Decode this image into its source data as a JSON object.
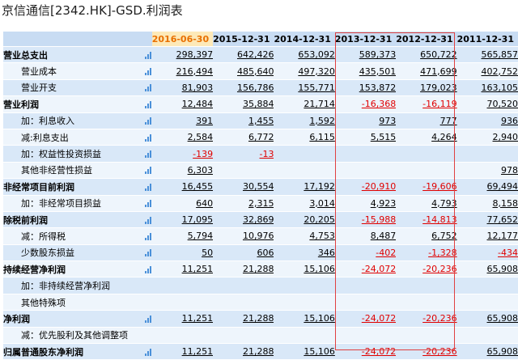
{
  "page": {
    "title": "京信通信[2342.HK]-GSD.利润表"
  },
  "table": {
    "headers": [
      "2016-06-30",
      "2015-12-31",
      "2014-12-31",
      "2013-12-31",
      "2012-12-31",
      "2011-12-31"
    ],
    "rows": [
      {
        "label": "营业总支出",
        "bold": true,
        "chart": true,
        "values": [
          "298,397",
          "642,426",
          "653,092",
          "589,373",
          "650,722",
          "565,857"
        ]
      },
      {
        "label": "营业成本",
        "sub": true,
        "chart": true,
        "values": [
          "216,494",
          "485,640",
          "497,320",
          "435,501",
          "471,699",
          "402,752"
        ]
      },
      {
        "label": "营业开支",
        "sub": true,
        "chart": true,
        "values": [
          "81,903",
          "156,786",
          "155,771",
          "153,872",
          "179,023",
          "163,105"
        ]
      },
      {
        "label": "营业利润",
        "bold": true,
        "chart": true,
        "values": [
          "12,484",
          "35,884",
          "21,714",
          "-16,368",
          "-16,119",
          "70,520"
        ]
      },
      {
        "label": "加：利息收入",
        "sub": true,
        "chart": true,
        "values": [
          "391",
          "1,455",
          "1,592",
          "973",
          "777",
          "936"
        ]
      },
      {
        "label": "减:利息支出",
        "sub": true,
        "chart": true,
        "values": [
          "2,584",
          "6,772",
          "6,115",
          "5,515",
          "4,264",
          "2,940"
        ]
      },
      {
        "label": "加：权益性投资损益",
        "sub": true,
        "chart": true,
        "values": [
          "-139",
          "-13",
          "",
          "",
          "",
          ""
        ]
      },
      {
        "label": "其他非经营性损益",
        "sub": true,
        "chart": true,
        "values": [
          "6,303",
          "",
          "",
          "",
          "",
          "978"
        ]
      },
      {
        "label": "非经常项目前利润",
        "bold": true,
        "chart": true,
        "values": [
          "16,455",
          "30,554",
          "17,192",
          "-20,910",
          "-19,606",
          "69,494"
        ]
      },
      {
        "label": "加：非经常项目损益",
        "sub": true,
        "chart": true,
        "values": [
          "640",
          "2,315",
          "3,014",
          "4,923",
          "4,793",
          "8,158"
        ]
      },
      {
        "label": "除税前利润",
        "bold": true,
        "chart": true,
        "values": [
          "17,095",
          "32,869",
          "20,205",
          "-15,988",
          "-14,813",
          "77,652"
        ]
      },
      {
        "label": "减：所得税",
        "sub": true,
        "chart": true,
        "values": [
          "5,794",
          "10,976",
          "4,753",
          "8,487",
          "6,752",
          "12,177"
        ]
      },
      {
        "label": "少数股东损益",
        "sub": true,
        "chart": true,
        "values": [
          "50",
          "606",
          "346",
          "-402",
          "-1,328",
          "-434"
        ]
      },
      {
        "label": "持续经营净利润",
        "bold": true,
        "chart": true,
        "values": [
          "11,251",
          "21,288",
          "15,106",
          "-24,072",
          "-20,236",
          "65,908"
        ]
      },
      {
        "label": "加：非持续经营净利润",
        "sub": true,
        "chart": false,
        "values": [
          "",
          "",
          "",
          "",
          "",
          ""
        ]
      },
      {
        "label": "其他特殊项",
        "sub": true,
        "chart": false,
        "values": [
          "",
          "",
          "",
          "",
          "",
          ""
        ]
      },
      {
        "label": "净利润",
        "bold": true,
        "chart": true,
        "values": [
          "11,251",
          "21,288",
          "15,106",
          "-24,072",
          "-20,236",
          "65,908"
        ]
      },
      {
        "label": "减：优先股利及其他调整项",
        "sub": true,
        "chart": false,
        "values": [
          "",
          "",
          "",
          "",
          "",
          ""
        ]
      },
      {
        "label": "归属普通股东净利润",
        "bold": true,
        "chart": true,
        "values": [
          "11,251",
          "21,288",
          "15,106",
          "-24,072",
          "-20,236",
          "65,908"
        ]
      }
    ]
  },
  "colors": {
    "negative": "#e00000",
    "first_header": "#e87000",
    "highlight_box": "#e04040",
    "icon": "#4a90d9"
  },
  "icons": {
    "row_chart": "bar-chart-icon"
  }
}
